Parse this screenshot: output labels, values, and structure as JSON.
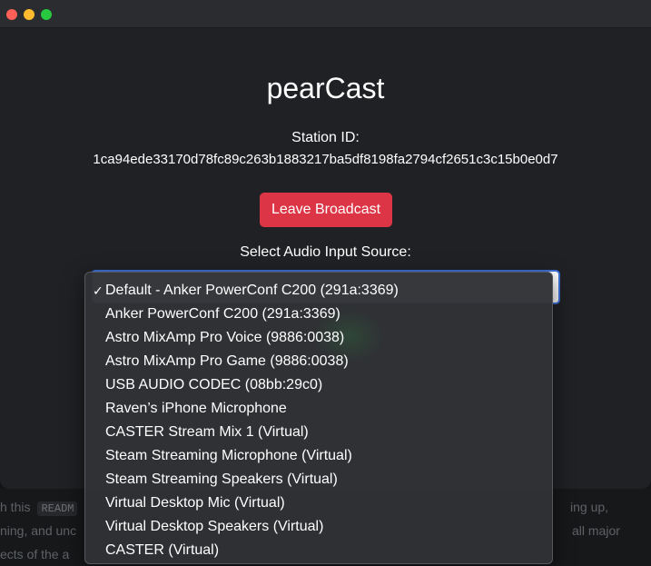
{
  "window": {
    "traffic_lights": {
      "close": "#fe5f57",
      "minimize": "#febc2e",
      "maximize": "#28c840"
    }
  },
  "app": {
    "title": "pearCast",
    "station_label": "Station ID:",
    "station_id": "1ca94ede33170d78fc89c263b1883217ba5df8198fa2794cf2651c3c15b0e0d7",
    "leave_button_label": "Leave Broadcast",
    "select_label": "Select Audio Input Source:",
    "accent_danger": "#dc3545",
    "accent_focus": "#3d6fd8"
  },
  "dropdown": {
    "selected_index": 0,
    "check_glyph": "✓",
    "options": [
      "Default - Anker PowerConf C200 (291a:3369)",
      "Anker PowerConf C200 (291a:3369)",
      "Astro MixAmp Pro Voice (9886:0038)",
      "Astro MixAmp Pro Game (9886:0038)",
      "USB AUDIO CODEC (08bb:29c0)",
      "Raven’s iPhone Microphone",
      "CASTER Stream Mix 1 (Virtual)",
      "Steam Streaming Microphone (Virtual)",
      "Steam Streaming Speakers (Virtual)",
      "Virtual Desktop Mic (Virtual)",
      "Virtual Desktop Speakers (Virtual)",
      "CASTER (Virtual)"
    ]
  },
  "background_page": {
    "line1_left": "h this",
    "line1_code": "READM",
    "line1_right": "ing up,",
    "line2_left": "ning, and unc",
    "line2_right": "all major",
    "line3_left": "ects of the a"
  }
}
